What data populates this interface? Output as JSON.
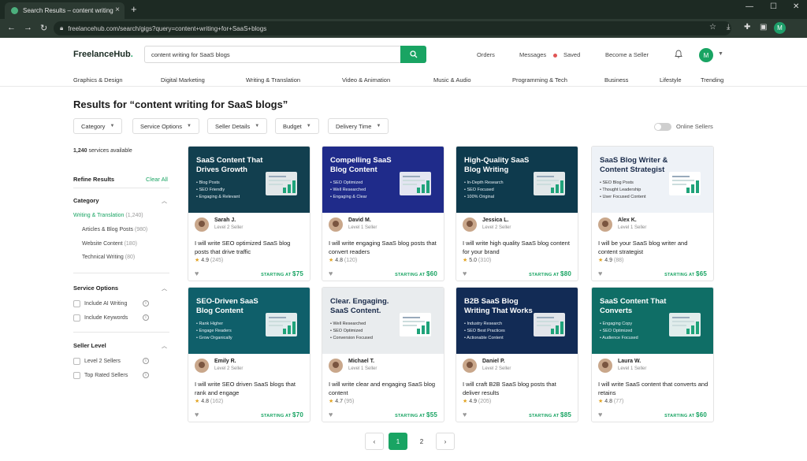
{
  "browser": {
    "tab_title": "Search Results – content writing",
    "url": "freelancehub.com/search/gigs?query=content+writing+for+SaaS+blogs",
    "profile_initial": "M"
  },
  "header": {
    "logo_main": "FreelanceHub",
    "logo_dot": ".",
    "search_value": "content writing for SaaS blogs",
    "links": {
      "orders": "Orders",
      "messages": "Messages",
      "saved": "Saved",
      "become_seller": "Become a Seller"
    },
    "user_initial": "M"
  },
  "categories": [
    "Graphics & Design",
    "Digital Marketing",
    "Writing & Translation",
    "Video & Animation",
    "Music & Audio",
    "Programming & Tech",
    "Business",
    "Lifestyle",
    "Trending"
  ],
  "results_title": "Results for “content writing for SaaS blogs”",
  "filters": [
    "Category",
    "Service Options",
    "Seller Details",
    "Budget",
    "Delivery Time"
  ],
  "online_sellers_label": "Online Sellers",
  "sidebar": {
    "count_num": "1,240",
    "count_text": " services available",
    "refine": "Refine Results",
    "clear_all": "Clear All",
    "category_heading": "Category",
    "category_items": [
      {
        "label": "Writing & Translation",
        "count": "(1,240)"
      },
      {
        "label": "Articles & Blog Posts",
        "count": "(980)"
      },
      {
        "label": "Website Content",
        "count": "(180)"
      },
      {
        "label": "Technical Writing",
        "count": "(80)"
      }
    ],
    "service_heading": "Service Options",
    "service_items": [
      "Include AI Writing",
      "Include Keywords"
    ],
    "seller_heading": "Seller Level",
    "seller_items": [
      "Level 2 Sellers",
      "Top Rated Sellers"
    ]
  },
  "gigs": [
    {
      "thumb_title": "SaaS Content That Drives Growth",
      "bullets": [
        "• Blog Posts",
        "• SEO Friendly",
        "• Engaging & Relevant"
      ],
      "bg": "#123f4f",
      "seller": "Sarah J.",
      "level": "Level 2 Seller",
      "title": "I will write SEO optimized SaaS blog posts that drive traffic",
      "rating": "4.9",
      "reviews": "(245)",
      "price_label": "STARTING AT ",
      "price": "$75"
    },
    {
      "thumb_title": "Compelling SaaS Blog Content",
      "bullets": [
        "• SEO Optimized",
        "• Well Researched",
        "• Engaging & Clear"
      ],
      "bg": "#1f2b8a",
      "seller": "David M.",
      "level": "Level 1 Seller",
      "title": "I will write engaging SaaS blog posts that convert readers",
      "rating": "4.8",
      "reviews": "(120)",
      "price_label": "STARTING AT ",
      "price": "$60"
    },
    {
      "thumb_title": "High-Quality SaaS Blog Writing",
      "bullets": [
        "• In-Depth Research",
        "• SEO Focused",
        "• 100% Original"
      ],
      "bg": "#0e3a4d",
      "seller": "Jessica L.",
      "level": "Level 2 Seller",
      "title": "I will write high quality SaaS blog content for your brand",
      "rating": "5.0",
      "reviews": "(310)",
      "price_label": "STARTING AT ",
      "price": "$80"
    },
    {
      "thumb_title": "SaaS Blog Writer & Content Strategist",
      "bullets": [
        "• SEO Blog Posts",
        "• Thought Leadership",
        "• User Focused Content"
      ],
      "bg": "#eef2f7",
      "seller": "Alex K.",
      "level": "Level 1 Seller",
      "title": "I will be your SaaS blog writer and content strategist",
      "rating": "4.9",
      "reviews": "(88)",
      "price_label": "STARTING AT ",
      "price": "$65"
    },
    {
      "thumb_title": "SEO-Driven SaaS Blog Content",
      "bullets": [
        "• Rank Higher",
        "• Engage Readers",
        "• Grow Organically"
      ],
      "bg": "#0f5f6a",
      "seller": "Emily R.",
      "level": "Level 2 Seller",
      "title": "I will write SEO driven SaaS blogs that rank and engage",
      "rating": "4.8",
      "reviews": "(162)",
      "price_label": "STARTING AT ",
      "price": "$70"
    },
    {
      "thumb_title": "Clear. Engaging. SaaS Content.",
      "bullets": [
        "• Well Researched",
        "• SEO Optimized",
        "• Conversion Focused"
      ],
      "bg": "#e9ecee",
      "seller": "Michael T.",
      "level": "Level 1 Seller",
      "title": "I will write clear and engaging SaaS blog content",
      "rating": "4.7",
      "reviews": "(95)",
      "price_label": "STARTING AT ",
      "price": "$55"
    },
    {
      "thumb_title": "B2B SaaS Blog Writing That Works",
      "bullets": [
        "• Industry Research",
        "• SEO Best Practices",
        "• Actionable Content"
      ],
      "bg": "#122b55",
      "seller": "Daniel P.",
      "level": "Level 2 Seller",
      "title": "I will craft B2B SaaS blog posts that deliver results",
      "rating": "4.9",
      "reviews": "(205)",
      "price_label": "STARTING AT ",
      "price": "$85"
    },
    {
      "thumb_title": "SaaS Content That Converts",
      "bullets": [
        "• Engaging Copy",
        "• SEO Optimized",
        "• Audience Focused"
      ],
      "bg": "#0f6e66",
      "seller": "Laura W.",
      "level": "Level 1 Seller",
      "title": "I will write SaaS content that converts and retains",
      "rating": "4.8",
      "reviews": "(77)",
      "price_label": "STARTING AT ",
      "price": "$60"
    }
  ],
  "pagination": {
    "prev": "‹",
    "pages": [
      "1",
      "2"
    ],
    "next": "›"
  },
  "colors": {
    "accent": "#19a463"
  }
}
